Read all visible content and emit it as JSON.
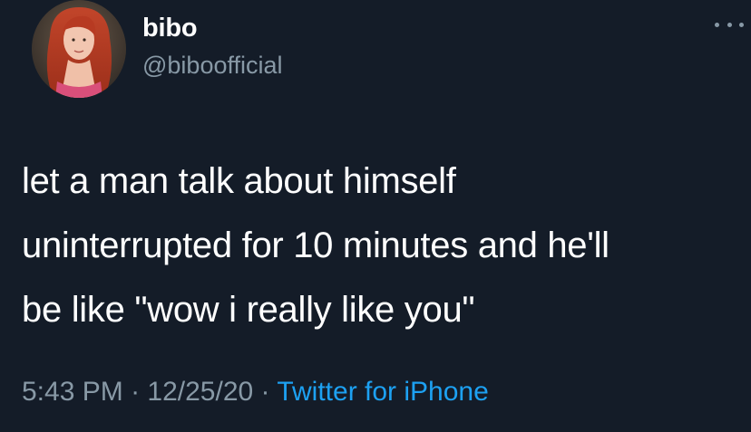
{
  "user": {
    "display_name": "bibo",
    "handle": "@biboofficial"
  },
  "tweet": {
    "lines": [
      "let a man talk about himself",
      "uninterrupted for 10 minutes and he'll",
      "be like \"wow i really like you\""
    ],
    "time": "5:43 PM",
    "separator": "·",
    "date": "12/25/20",
    "source": "Twitter for iPhone"
  },
  "icons": {
    "more": "more-options-icon",
    "avatar": "profile-avatar"
  },
  "colors": {
    "background": "#141c28",
    "text": "#ffffff",
    "secondary_text": "#8899a6",
    "link": "#1da1f2"
  }
}
